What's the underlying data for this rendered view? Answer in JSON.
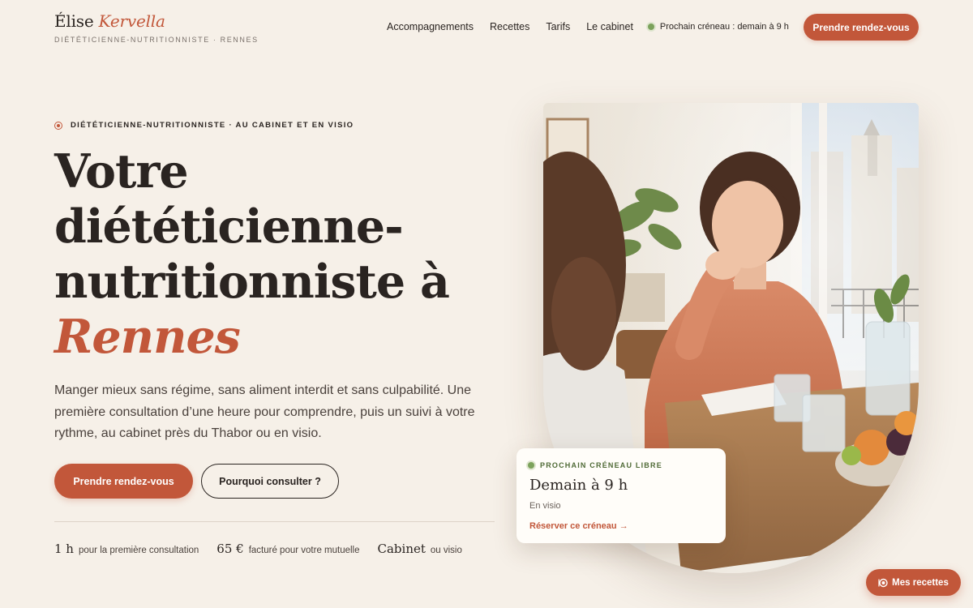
{
  "brand": {
    "first": "Élise",
    "last": "Kervella",
    "tagline": "DIÉTÉTICIENNE-NUTRITIONNISTE · RENNES"
  },
  "nav": {
    "items": [
      "Accompagnements",
      "Recettes",
      "Tarifs",
      "Le cabinet"
    ],
    "slot_status": "Prochain créneau : demain à 9 h",
    "cta": "Prendre rendez-vous"
  },
  "hero": {
    "eyebrow": "DIÉTÉTICIENNE-NUTRITIONNISTE · AU CABINET ET EN VISIO",
    "headline_lines": [
      "Votre",
      "diététicienne-",
      "nutritionniste à"
    ],
    "headline_accent": "Rennes",
    "lead": "Manger mieux sans régime, sans aliment interdit et sans culpabilité. Une première consultation d’une heure pour comprendre, puis un suivi à votre rythme, au cabinet près du Thabor ou en visio.",
    "cta_primary": "Prendre rendez-vous",
    "cta_secondary": "Pourquoi consulter ?",
    "stats": [
      {
        "value": "1 h",
        "label": "pour la première consultation"
      },
      {
        "value": "65 €",
        "label": "facturé pour votre mutuelle"
      },
      {
        "value": "Cabinet",
        "label": "ou visio"
      }
    ]
  },
  "slot_card": {
    "eyebrow": "PROCHAIN CRÉNEAU LIBRE",
    "title": "Demain à 9 h",
    "mode": "En visio",
    "link": "Réserver ce créneau →"
  },
  "fab": {
    "label": "Mes recettes",
    "icon": "plate-icon"
  },
  "colors": {
    "accent": "#c2573a",
    "background": "#f6f0e8",
    "green": "#7ca25c",
    "text": "#2a2421"
  }
}
